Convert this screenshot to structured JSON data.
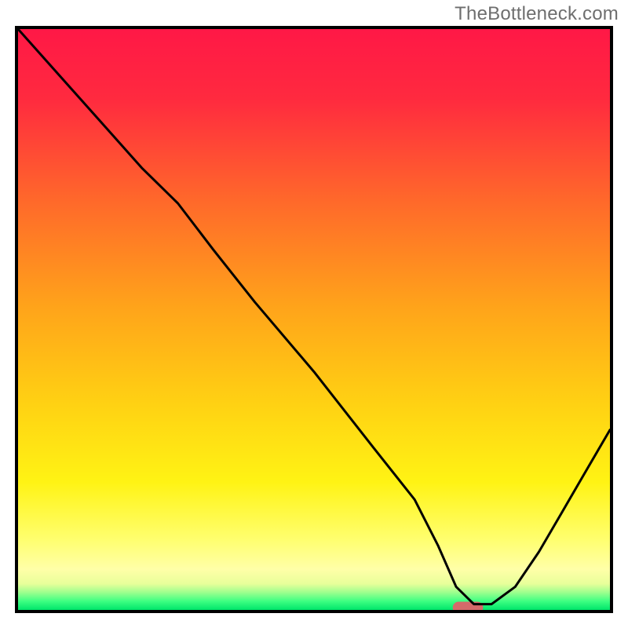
{
  "watermark": "TheBottleneck.com",
  "chart_data": {
    "type": "line",
    "title": "",
    "xlabel": "",
    "ylabel": "",
    "xlim": [
      0,
      100
    ],
    "ylim": [
      0,
      100
    ],
    "grid": false,
    "series": [
      {
        "name": "curve",
        "x": [
          0,
          7,
          21,
          27,
          33,
          40,
          50,
          60,
          67,
          71,
          74,
          77,
          80,
          84,
          88,
          92,
          96,
          100
        ],
        "values": [
          100,
          92,
          76,
          70,
          62,
          53,
          41,
          28,
          19,
          11,
          4,
          1,
          1,
          4,
          10,
          17,
          24,
          31
        ]
      }
    ],
    "marker": {
      "x": 76,
      "width_pct": 5
    },
    "gradient_stops": [
      {
        "offset": 0.0,
        "color": "#ff1846"
      },
      {
        "offset": 0.12,
        "color": "#ff2a3f"
      },
      {
        "offset": 0.3,
        "color": "#ff6a2a"
      },
      {
        "offset": 0.48,
        "color": "#ffa41a"
      },
      {
        "offset": 0.64,
        "color": "#ffd013"
      },
      {
        "offset": 0.78,
        "color": "#fff314"
      },
      {
        "offset": 0.88,
        "color": "#ffff70"
      },
      {
        "offset": 0.93,
        "color": "#ffffa8"
      },
      {
        "offset": 0.955,
        "color": "#e8ff9a"
      },
      {
        "offset": 0.97,
        "color": "#9cff8e"
      },
      {
        "offset": 0.985,
        "color": "#3dff82"
      },
      {
        "offset": 1.0,
        "color": "#00e56a"
      }
    ],
    "axis_color": "#000000",
    "line_color": "#000000",
    "marker_fill": "#d46a6a",
    "marker_stroke": "#d46a6a"
  }
}
